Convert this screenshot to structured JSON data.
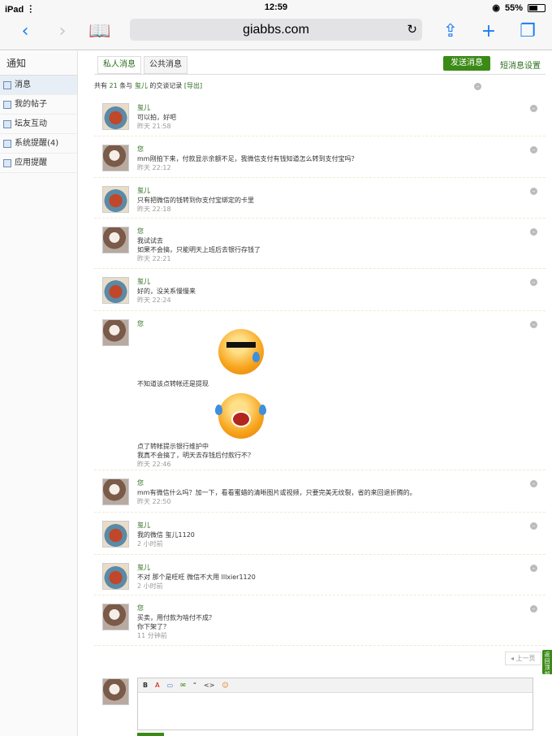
{
  "status": {
    "device": "iPad",
    "time": "12:59",
    "battery": "55%",
    "battery_level": 0.55
  },
  "browser": {
    "url": "giabbs.com"
  },
  "sidebar": {
    "title": "通知",
    "items": [
      {
        "label": "消息",
        "icon": "mail-icon",
        "active": true
      },
      {
        "label": "我的帖子",
        "icon": "document-icon",
        "active": false
      },
      {
        "label": "坛友互动",
        "icon": "chat-icon",
        "active": false
      },
      {
        "label": "系统提醒(4)",
        "icon": "gear-icon",
        "active": false
      },
      {
        "label": "应用提醒",
        "icon": "grid-icon",
        "active": false
      }
    ]
  },
  "tabs": {
    "private": "私人消息",
    "public": "公共消息",
    "send": "发送消息",
    "settings": "短消息设置"
  },
  "summary": {
    "prefix": "共有",
    "count": "21",
    "mid": "条与",
    "user": "玺儿",
    "suffix": "的交谈记录",
    "export": "[导出]"
  },
  "messages": [
    {
      "author": "玺儿",
      "avatar": "fox",
      "lines": [
        "可以拍，好吧"
      ],
      "time": "昨天 21:58"
    },
    {
      "author": "您",
      "avatar": "me",
      "lines": [
        "mm刚拍下来，付款显示余额不足，我微信支付有钱知道怎么转到支付宝吗？"
      ],
      "time": "昨天 22:12"
    },
    {
      "author": "玺儿",
      "avatar": "fox",
      "lines": [
        "只有把微信的钱转到你支付宝绑定的卡里"
      ],
      "time": "昨天 22:18"
    },
    {
      "author": "您",
      "avatar": "me",
      "lines": [
        "我试试去",
        "如果不会搞，只能明天上班后去银行存钱了"
      ],
      "time": "昨天 22:21"
    },
    {
      "author": "玺儿",
      "avatar": "fox",
      "lines": [
        "好的，没关系慢慢来"
      ],
      "time": "昨天 22:24"
    },
    {
      "author": "您",
      "avatar": "me",
      "lines": [
        "不知道该点转帐还是提现",
        "点了转帐提示银行维护中",
        "我真不会搞了，明天去存钱后付款行不？"
      ],
      "time": "昨天 22:46"
    },
    {
      "author": "您",
      "avatar": "me",
      "lines": [
        "mm有微信什么吗？加一下，看看蜜蜡的清晰图片或视频，只要完美无纹裂，省的来回退折腾的。"
      ],
      "time": "昨天 22:50"
    },
    {
      "author": "玺儿",
      "avatar": "fox",
      "lines": [
        "我的微信 玺儿1120"
      ],
      "time": "2 小时前"
    },
    {
      "author": "玺儿",
      "avatar": "fox",
      "lines": [
        "不对 那个是旺旺 微信不大用 lllxier1120"
      ],
      "time": "2 小时前"
    },
    {
      "author": "您",
      "avatar": "me",
      "lines": [
        "买卖，用付款为啥付不成？",
        "你下架了？"
      ],
      "time": "11 分钟前"
    }
  ],
  "pager": {
    "prev": "上一页"
  },
  "side_tab": "返回顶部",
  "editor": {
    "tools": [
      "B",
      "A",
      "▭",
      "✉",
      "“",
      "<>",
      "☺"
    ]
  }
}
